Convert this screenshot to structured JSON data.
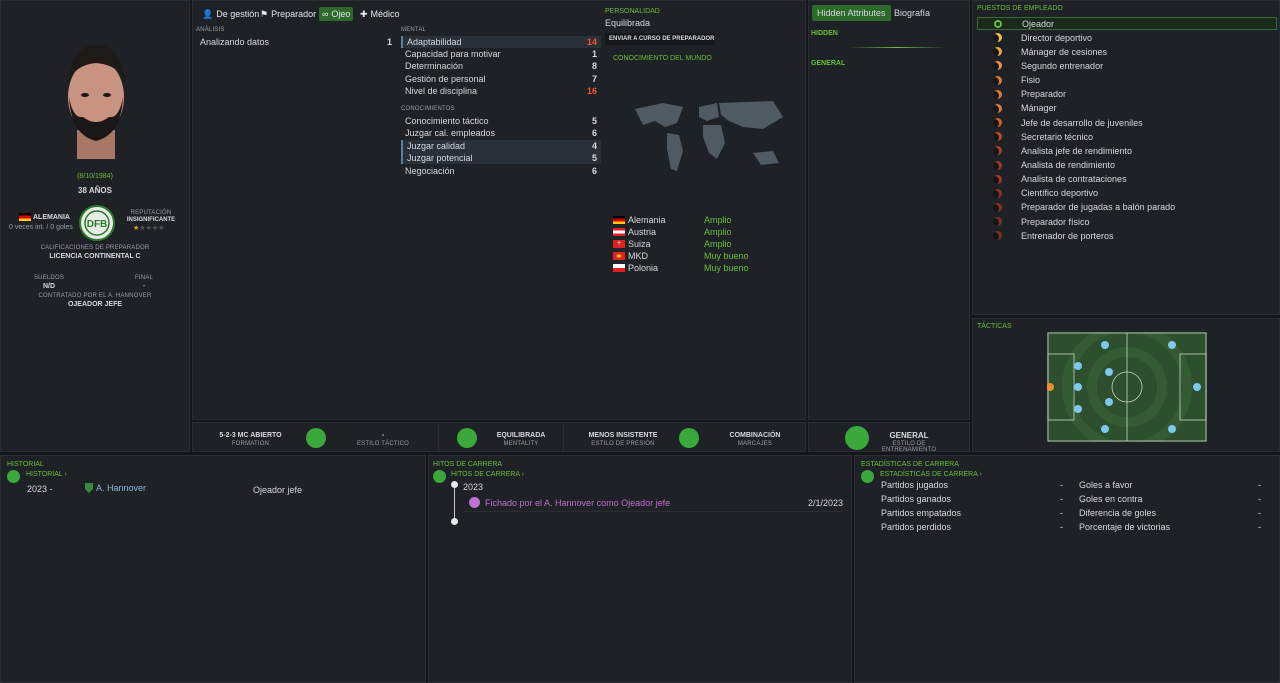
{
  "profile": {
    "dob": "(8/10/1984)",
    "age": "38 AÑOS",
    "nation": "ALEMANIA",
    "caps": "0 veces int. / 0 goles",
    "reputation_label": "REPUTACIÓN",
    "reputation": "INSIGNIFICANTE",
    "coach_quals_label": "CALIFICACIONES DE PREPARADOR",
    "coach_quals": "LICENCIA CONTINENTAL C",
    "wages_label": "SUELDOS",
    "wages": "N/D",
    "end_label": "FINAL",
    "end": "-",
    "contract_label": "CONTRATADO POR EL A. HANNOVER",
    "role": "OJEADOR JEFE",
    "reputation_stars": 1
  },
  "tabs": [
    {
      "label": "De gestión"
    },
    {
      "label": "Preparador"
    },
    {
      "label": "Ojeo"
    },
    {
      "label": "Médico"
    }
  ],
  "analysis": {
    "header": "ANÁLISIS",
    "items": [
      {
        "label": "Analizando datos",
        "value": "1"
      }
    ]
  },
  "mental": {
    "header": "MENTAL",
    "items": [
      {
        "label": "Adaptabilidad",
        "value": "14"
      },
      {
        "label": "Capacidad para motivar",
        "value": "1"
      },
      {
        "label": "Determinación",
        "value": "8"
      },
      {
        "label": "Gestión de personal",
        "value": "7"
      },
      {
        "label": "Nivel de disciplina",
        "value": "16"
      }
    ]
  },
  "knowledge": {
    "header": "CONOCIMIENTOS",
    "items": [
      {
        "label": "Conocimiento táctico",
        "value": "5"
      },
      {
        "label": "Juzgar cal. empleados",
        "value": "6"
      },
      {
        "label": "Juzgar calidad",
        "value": "4"
      },
      {
        "label": "Juzgar potencial",
        "value": "5"
      },
      {
        "label": "Negociación",
        "value": "6"
      }
    ]
  },
  "personality": {
    "header": "PERSONALIDAD",
    "value": "Equilibrada",
    "course_button": "ENVIAR A CURSO DE PREPARADOR"
  },
  "world": {
    "header": "CONOCIMIENTO DEL MUNDO",
    "countries": [
      {
        "name": "Alemania",
        "level": "Amplio"
      },
      {
        "name": "Austria",
        "level": "Amplio"
      },
      {
        "name": "Suiza",
        "level": "Amplio"
      },
      {
        "name": "MKD",
        "level": "Muy bueno"
      },
      {
        "name": "Polonia",
        "level": "Muy bueno"
      }
    ]
  },
  "right_tabs": {
    "hidden_attr": "Hidden Attributes",
    "bio": "Biografía",
    "hidden": "HIDDEN",
    "general": "GENERAL"
  },
  "staff_roles": {
    "header": "PUESTOS DE EMPLEADO",
    "items": [
      "Ojeador",
      "Director deportivo",
      "Mánager de cesiones",
      "Segundo entrenador",
      "Fisio",
      "Preparador",
      "Mánager",
      "Jefe de desarrollo de juveniles",
      "Secretario técnico",
      "Analista jefe de rendimiento",
      "Analista de rendimiento",
      "Analista de contrataciones",
      "Científico deportivo",
      "Preparador de jugadas a balón parado",
      "Preparador físico",
      "Entrenador de porteros"
    ]
  },
  "tactics_label": "TÁCTICAS",
  "bottom_bar": {
    "formation": "5-2-3 MC ABIERTO",
    "formation_sub": "FORMATION",
    "style": "-",
    "style_sub": "ESTILO TÁCTICO",
    "mentality": "EQUILIBRADA",
    "mentality_sub": "MENTALITY",
    "pressing": "MENOS INSISTENTE",
    "pressing_sub": "ESTILO DE PRESIÓN",
    "marking": "COMBINACIÓN",
    "marking_sub": "MARCAJES",
    "training": "GENERAL",
    "training_sub": "ESTILO DE ENTRENAMIENTO"
  },
  "history": {
    "header": "HISTORIAL",
    "link": "HISTORIAL ›",
    "year": "2023 -",
    "club": "A. Hannover",
    "role": "Ojeador jefe"
  },
  "milestones": {
    "header": "HITOS DE CARRERA",
    "link": "HITOS DE CARRERA ›",
    "year": "2023",
    "event": "Fichado por el A. Hannover como Ojeador jefe",
    "date": "2/1/2023"
  },
  "stats": {
    "header": "ESTADÍSTICAS DE CARRERA",
    "link": "ESTADÍSTICAS DE CARRERA ›",
    "left": [
      {
        "label": "Partidos jugados",
        "value": "-"
      },
      {
        "label": "Partidos ganados",
        "value": "-"
      },
      {
        "label": "Partidos empatados",
        "value": "-"
      },
      {
        "label": "Partidos perdidos",
        "value": "-"
      }
    ],
    "right": [
      {
        "label": "Goles a favor",
        "value": "-"
      },
      {
        "label": "Goles en contra",
        "value": "-"
      },
      {
        "label": "Diferencia de goles",
        "value": "-"
      },
      {
        "label": "Porcentaje de victorias",
        "value": "-"
      }
    ]
  },
  "colors": {
    "accent": "#6bbf3a",
    "highlight": "#f05a28"
  }
}
